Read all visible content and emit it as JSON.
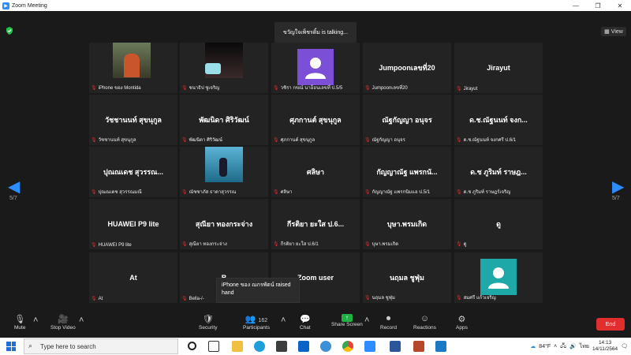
{
  "window": {
    "title": "Zoom Meeting"
  },
  "meeting": {
    "talking_text": "ขวัญใจเพ็ชรดิ้ม is talking...",
    "view_label": "View",
    "page_left": "5/7",
    "page_right": "5/7",
    "raised_hand_text": "iPhone ของ ณกรพัตน์ raised hand"
  },
  "tiles": [
    {
      "name": "",
      "label": "iPhone ของ Montida"
    },
    {
      "name": "",
      "label": "ชนาธิป ชูเจริญ"
    },
    {
      "name": "",
      "label": "วชิรา กขณ์ นาอ็อนเลขที่ ป.5/5"
    },
    {
      "name": "Jumpoonเลขที่20",
      "label": "Jumpoonเลขที่20"
    },
    {
      "name": "Jirayut",
      "label": "Jirayut"
    },
    {
      "name": "วัชชานนท์ สุขนุกูล",
      "label": "วัชชานนท์ สุขนุกูล"
    },
    {
      "name": "พัฒนิดา ศิริวัฒน์",
      "label": "พัฒนิดา ศิริวัฒน์"
    },
    {
      "name": "ศุภกานต์ สุขนุกูล",
      "label": "ศุภกานต์ สุขนุกูล"
    },
    {
      "name": "ณัฐกัญญา อนุจร",
      "label": "ณัฐกัญญา อนุจร"
    },
    {
      "name": "ด.ช.ณัฐนนท์ จงก...",
      "label": "ด.ช.ณัฐนนท์ จงกศรี ป.6/1"
    },
    {
      "name": "ปุณณเดช สุวรรณ...",
      "label": "ปุณณเดช สุวรรณมณี"
    },
    {
      "name": "",
      "label": "ณัชชาภัส ธาดาสุวรรณ"
    },
    {
      "name": "ศลิษา",
      "label": "ศลิษา"
    },
    {
      "name": "กัญญาณัฐ แพรกนั...",
      "label": "กัญญาณัฐ แพรกนิมแอ ป.5/1"
    },
    {
      "name": "ด.ช ภูริมท์ ราษฎ...",
      "label": "ด.ช ภูริมท์ ราษฎร์เจริญ"
    },
    {
      "name": "HUAWEI P9 lite",
      "label": "HUAWEI P9 lite"
    },
    {
      "name": "สุณียา ทองกระจ่าง",
      "label": "สุณียา ทองกระจ่าง"
    },
    {
      "name": "กีรติยา ยะใส ป.6...",
      "label": "กีรติยา ยะใส ป.6/1"
    },
    {
      "name": "บุษา.พรมเกิด",
      "label": "บุษา.พรมเกิด"
    },
    {
      "name": "ดู",
      "label": "ดู"
    },
    {
      "name": "At",
      "label": "At"
    },
    {
      "name": "B",
      "label": "Bella-/-"
    },
    {
      "name": "Zoom user",
      "label": "user"
    },
    {
      "name": "นฤมล ชูฟุ่ม",
      "label": "นฤมล ชูฟุ่ม"
    },
    {
      "name": "",
      "label": "สมศรี แก้วเจริญ"
    }
  ],
  "toolbar": {
    "mute": "Mute",
    "stop_video": "Stop Video",
    "security": "Security",
    "participants": "Participants",
    "participants_count": "162",
    "chat": "Chat",
    "share_screen": "Share Screen",
    "record": "Record",
    "reactions": "Reactions",
    "apps": "Apps",
    "end": "End"
  },
  "taskbar": {
    "search_placeholder": "Type here to search",
    "weather": "84°F",
    "lang": "ไทย",
    "time": "14:13",
    "date": "14/11/2564"
  },
  "colors": {
    "accent": "#2d8cff",
    "end": "#e02d2d",
    "share": "#1fb141"
  }
}
